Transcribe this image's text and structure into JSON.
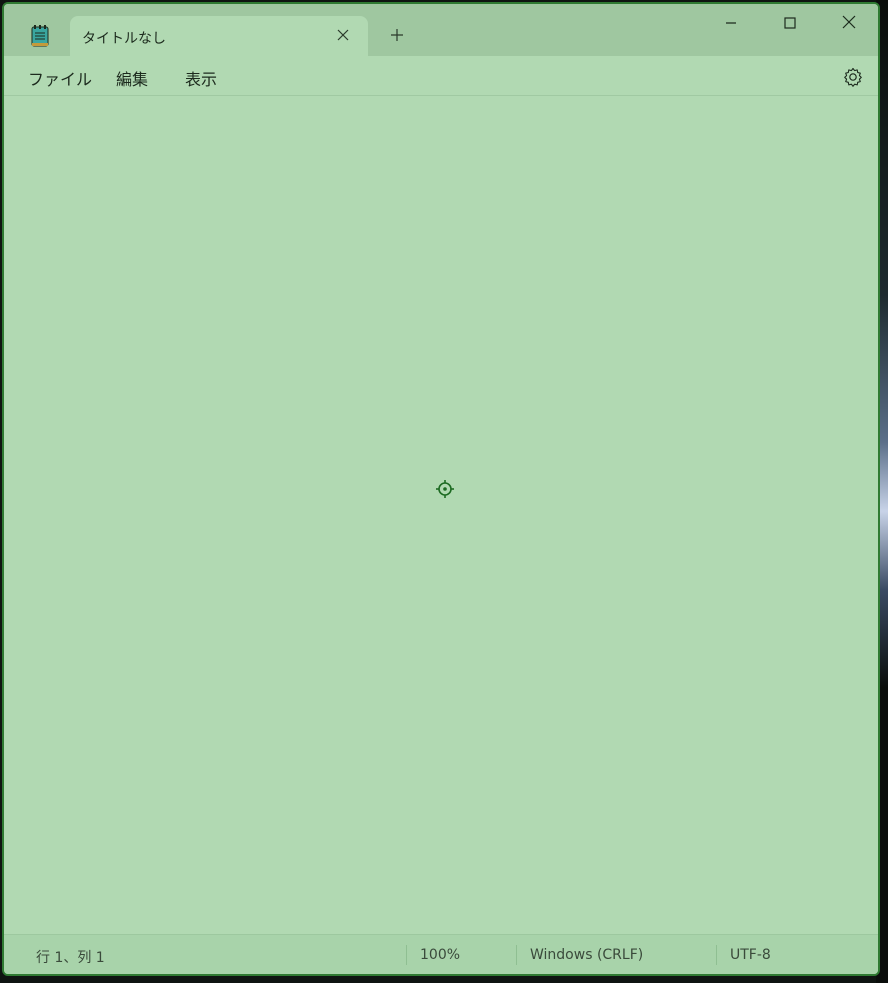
{
  "window": {
    "tab_title": "タイトルなし"
  },
  "menu": {
    "file": "ファイル",
    "edit": "編集",
    "view": "表示"
  },
  "statusbar": {
    "position": "行 1、列 1",
    "zoom": "100%",
    "line_ending": "Windows (CRLF)",
    "encoding": "UTF-8"
  },
  "icons": {
    "app": "notepad-icon",
    "tab_close": "close-icon",
    "new_tab": "plus-icon",
    "minimize": "minimize-icon",
    "maximize": "maximize-icon",
    "close": "close-icon",
    "settings": "gear-icon",
    "cursor": "target-icon"
  },
  "colors": {
    "background": "#b1d9b2",
    "titlebar": "#9fc7a0",
    "border": "#2f7a32"
  }
}
